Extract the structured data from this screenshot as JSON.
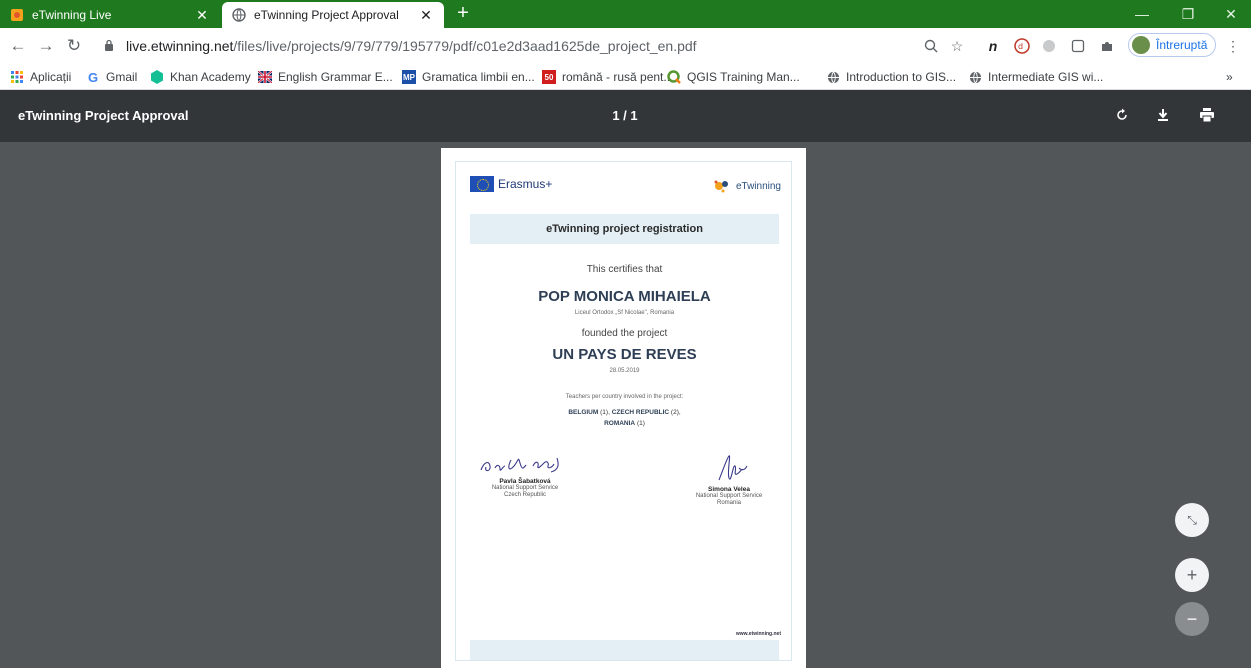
{
  "tabs": [
    {
      "title": "eTwinning Live",
      "icon": "etwinning-icon",
      "active": false
    },
    {
      "title": "eTwinning Project Approval",
      "icon": "globe-icon",
      "active": true
    }
  ],
  "address": {
    "host": "live.etwinning.net",
    "path": "/files/live/projects/9/79/779/195779/pdf/c01e2d3aad1625de_project_en.pdf"
  },
  "profile": {
    "label": "Întreruptă"
  },
  "bookmarks": [
    {
      "label": "Aplicații",
      "icon": "apps-grid-icon"
    },
    {
      "label": "Gmail",
      "icon": "google-icon"
    },
    {
      "label": "Khan Academy",
      "icon": "khan-academy-icon"
    },
    {
      "label": "English Grammar E...",
      "icon": "uk-flag-icon"
    },
    {
      "label": "Gramatica limbii en...",
      "icon": "mp-icon",
      "badge": "MP"
    },
    {
      "label": "română - rusă pent...",
      "icon": "fifty-icon",
      "badge": "50"
    },
    {
      "label": "QGIS Training Man...",
      "icon": "qgis-icon"
    },
    {
      "label": "Introduction to GIS...",
      "icon": "globe-icon"
    },
    {
      "label": "Intermediate GIS wi...",
      "icon": "globe-icon"
    }
  ],
  "pdf": {
    "title": "eTwinning Project Approval",
    "pages": "1 / 1"
  },
  "certificate": {
    "erasmus": "Erasmus+",
    "etwinning": "eTwinning",
    "heading": "eTwinning project registration",
    "certifies": "This certifies that",
    "name": "POP MONICA MIHAIELA",
    "school": "Liceul Ortodox „Sf Nicolae\", Romania",
    "founded": "founded the project",
    "project": "UN PAYS DE REVES",
    "date": "28.05.2019",
    "teachers_label": "Teachers per country involved in the project:",
    "countries": [
      {
        "name": "BELGIUM",
        "count": "(1)"
      },
      {
        "name": "CZECH REPUBLIC",
        "count": "(2)"
      },
      {
        "name": "ROMANIA",
        "count": "(1)"
      }
    ],
    "signatories": [
      {
        "name": "Pavla Šabatková",
        "role": "National Support Service",
        "country": "Czech Republic"
      },
      {
        "name": "Simona Velea",
        "role": "National Support Service",
        "country": "Romania"
      }
    ],
    "website": "www.etwinning.net"
  },
  "colors": {
    "tab_strip": "#1f7a1f",
    "pdf_toolbar": "#323639",
    "viewer_background": "#525659",
    "band": "#e3eff5"
  }
}
